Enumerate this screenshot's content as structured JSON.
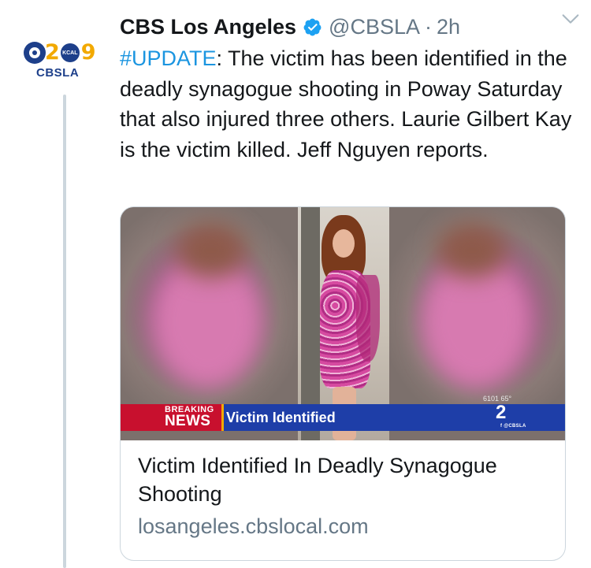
{
  "avatar": {
    "logo_digit_left": "2",
    "logo_digit_right": "9",
    "logo_badge": "KCAL",
    "name": "CBSLA",
    "colors": {
      "blue": "#1d3f8a",
      "gold": "#f2a900"
    }
  },
  "header": {
    "display_name": "CBS Los Angeles",
    "verified_icon": "verified-badge-icon",
    "handle": "@CBSLA",
    "separator": "·",
    "timestamp": "2h",
    "menu_icon": "chevron-down-icon"
  },
  "tweet": {
    "hashtag": "#UPDATE",
    "text": ": The victim has been identified in the deadly synagogue shooting in Poway Saturday that also injured three others. Laurie Gilbert Kay is the victim killed. Jeff Nguyen reports."
  },
  "card": {
    "image": {
      "banner_top": "BREAKING",
      "banner_bottom": "NEWS",
      "banner_text": "Victim Identified",
      "temperature": "6101 65°",
      "station_number": "2",
      "station_tag": "f @CBSLA"
    },
    "title": "Victim Identified In Deadly Synagogue Shooting",
    "domain": "losangeles.cbslocal.com"
  },
  "colors": {
    "link_blue": "#1b95e0",
    "text": "#14171a",
    "muted": "#657786",
    "border": "#ccd6dd",
    "breaking_red": "#c8102e",
    "banner_blue": "#1e3ea8"
  }
}
